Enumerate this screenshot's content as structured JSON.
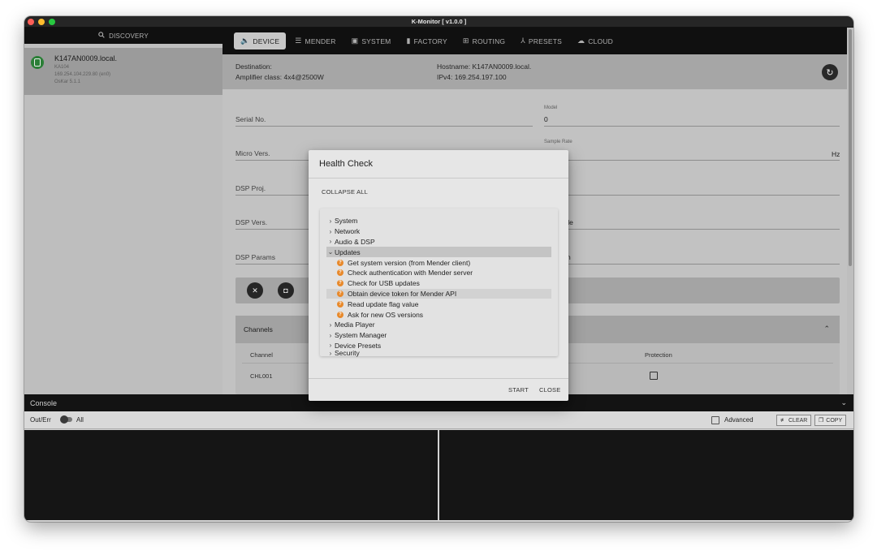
{
  "window": {
    "title": "K-Monitor [ v1.0.0 ]",
    "traffic_colors": [
      "#fe5f57",
      "#febc2e",
      "#28c840"
    ]
  },
  "sidebar": {
    "header": "DISCOVERY",
    "device": {
      "name": "K147AN0009.local.",
      "model": "KA104",
      "ip": "169.254.104.229.80 (en0)",
      "version": "OsKar 5.1.1"
    }
  },
  "tabs": [
    {
      "label": "DEVICE",
      "icon": "speaker-icon",
      "glyph": "🔈"
    },
    {
      "label": "MENDER",
      "icon": "list-icon",
      "glyph": "☰"
    },
    {
      "label": "SYSTEM",
      "icon": "window-icon",
      "glyph": "▣"
    },
    {
      "label": "FACTORY",
      "icon": "bar-chart-icon",
      "glyph": "▮"
    },
    {
      "label": "ROUTING",
      "icon": "grid-icon",
      "glyph": "⊞"
    },
    {
      "label": "PRESETS",
      "icon": "hierarchy-icon",
      "glyph": "⅄"
    },
    {
      "label": "CLOUD",
      "icon": "cloud-icon",
      "glyph": "☁"
    }
  ],
  "destination": {
    "destination": "Destination:",
    "amp_class": "Amplifier class: 4x4@2500W",
    "hostname": "Hostname: K147AN0009.local.",
    "ipv4": "IPv4: 169.254.197.100"
  },
  "form": {
    "serial_label": "Serial No.",
    "model_label": "Model",
    "model_value": "0",
    "micro_label": "Micro Vers.",
    "sample_rate_label": "Sample Rate",
    "sample_rate_unit": "Hz",
    "dsp_proj_label": "DSP Proj.",
    "dsp_vers_label": "DSP Vers.",
    "dsp_vers_partial": "ilable",
    "dsp_params_label": "DSP Params",
    "dsp_params_partial": "n"
  },
  "channels": {
    "title": "Channels",
    "col_channel": "Channel",
    "col_protection": "Protection",
    "rows": [
      {
        "name": "CHL001"
      }
    ]
  },
  "modal": {
    "title": "Health Check",
    "collapse_all": "COLLAPSE ALL",
    "tree": [
      {
        "label": "System",
        "type": "collapsed"
      },
      {
        "label": "Network",
        "type": "collapsed"
      },
      {
        "label": "Audio & DSP",
        "type": "collapsed"
      },
      {
        "label": "Updates",
        "type": "expanded"
      },
      {
        "label": "Get system version (from Mender client)",
        "type": "warn"
      },
      {
        "label": "Check authentication with Mender server",
        "type": "warn"
      },
      {
        "label": "Check for USB updates",
        "type": "warn"
      },
      {
        "label": "Obtain device token for Mender API",
        "type": "warn"
      },
      {
        "label": "Read update flag value",
        "type": "warn"
      },
      {
        "label": "Ask for new OS versions",
        "type": "warn"
      },
      {
        "label": "Media Player",
        "type": "collapsed"
      },
      {
        "label": "System Manager",
        "type": "collapsed"
      },
      {
        "label": "Device Presets",
        "type": "collapsed"
      },
      {
        "label": "Security",
        "type": "collapsed"
      }
    ],
    "start": "START",
    "close": "CLOSE"
  },
  "console": {
    "title": "Console",
    "outerr": "Out/Err",
    "all": "All",
    "advanced": "Advanced",
    "clear": "CLEAR",
    "copy": "COPY"
  }
}
